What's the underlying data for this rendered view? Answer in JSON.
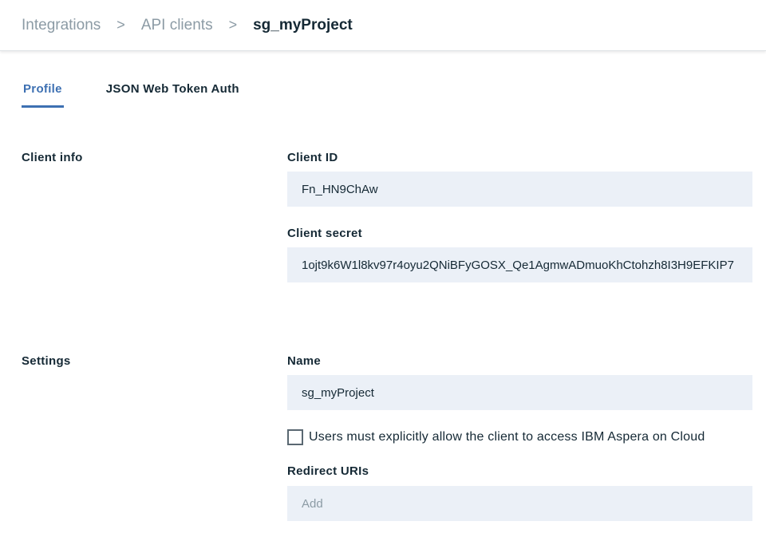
{
  "breadcrumb": {
    "items": [
      "Integrations",
      "API clients"
    ],
    "current": "sg_myProject",
    "separator": ">"
  },
  "tabs": {
    "profile": "Profile",
    "jwt": "JSON Web Token Auth"
  },
  "client_info": {
    "section_label": "Client info",
    "client_id_label": "Client ID",
    "client_id_value": "Fn_HN9ChAw",
    "client_secret_label": "Client secret",
    "client_secret_value": "1ojt9k6W1l8kv97r4oyu2QNiBFyGOSX_Qe1AgmwADmuoKhCtohzh8I3H9EFKIP7"
  },
  "settings": {
    "section_label": "Settings",
    "name_label": "Name",
    "name_value": "sg_myProject",
    "checkbox_label": "Users must explicitly allow the client to access IBM Aspera on Cloud",
    "redirect_label": "Redirect URIs",
    "redirect_placeholder": "Add"
  },
  "colors": {
    "accent": "#3d70b2",
    "field_bg": "#ebf0f7",
    "muted_text": "#8c9ba5"
  }
}
